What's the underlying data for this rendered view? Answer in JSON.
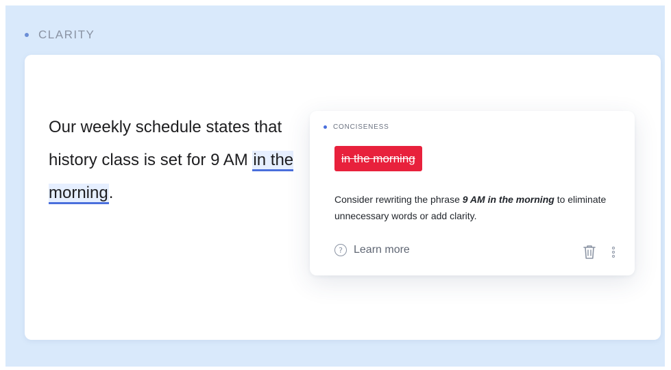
{
  "section": {
    "title": "CLARITY"
  },
  "document": {
    "text_before": "Our weekly schedule states that history class is set for 9 AM ",
    "highlighted": "in the morning",
    "text_after": "."
  },
  "suggestion": {
    "category": "CONCISENESS",
    "struck_text": "in the morning",
    "body_prefix": "Consider rewriting the phrase ",
    "body_emphasis": "9 AM in the morning",
    "body_suffix": " to eliminate unnecessary words or add clarity.",
    "learn_more_label": "Learn more",
    "icons": {
      "help": "question-circle-icon",
      "delete": "trash-icon",
      "more": "more-vertical-icon"
    }
  },
  "colors": {
    "background_panel": "#d9e9fb",
    "accent": "#4a6fdc",
    "error_chip": "#e8213c",
    "highlight_bg": "#e6efff"
  }
}
